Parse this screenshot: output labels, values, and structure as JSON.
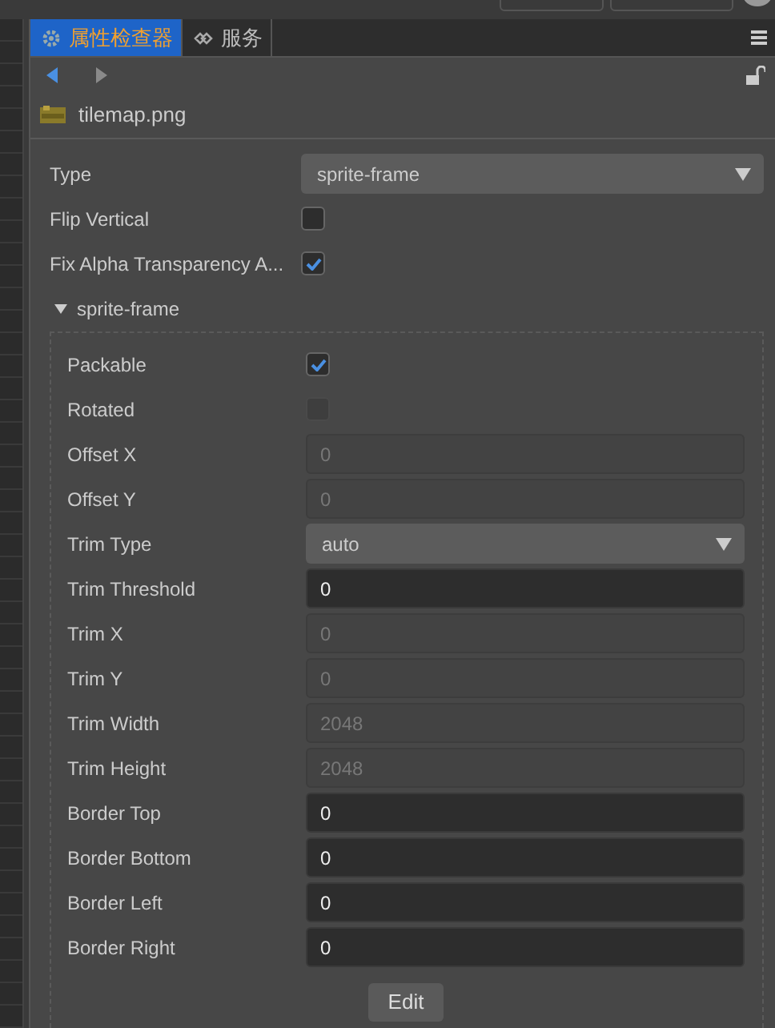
{
  "tabs": [
    {
      "label": "属性检查器",
      "selected": true
    },
    {
      "label": "服务",
      "selected": false
    }
  ],
  "asset": {
    "name": "tilemap.png"
  },
  "properties": [
    {
      "kind": "dropdown",
      "label": "Type",
      "value": "sprite-frame"
    },
    {
      "kind": "checkbox",
      "label": "Flip Vertical",
      "checked": false
    },
    {
      "kind": "checkbox",
      "label": "Fix Alpha Transparency A...",
      "checked": true
    }
  ],
  "section": {
    "title": "sprite-frame",
    "expanded": true,
    "properties": [
      {
        "kind": "checkbox",
        "label": "Packable",
        "checked": true
      },
      {
        "kind": "checkbox",
        "label": "Rotated",
        "checked": false,
        "disabled": true
      },
      {
        "kind": "number",
        "label": "Offset X",
        "value": "0",
        "disabled": true
      },
      {
        "kind": "number",
        "label": "Offset Y",
        "value": "0",
        "disabled": true
      },
      {
        "kind": "dropdown",
        "label": "Trim Type",
        "value": "auto"
      },
      {
        "kind": "number",
        "label": "Trim Threshold",
        "value": "0",
        "disabled": false
      },
      {
        "kind": "number",
        "label": "Trim X",
        "value": "0",
        "disabled": true
      },
      {
        "kind": "number",
        "label": "Trim Y",
        "value": "0",
        "disabled": true
      },
      {
        "kind": "number",
        "label": "Trim Width",
        "value": "2048",
        "disabled": true
      },
      {
        "kind": "number",
        "label": "Trim Height",
        "value": "2048",
        "disabled": true
      },
      {
        "kind": "number",
        "label": "Border Top",
        "value": "0",
        "disabled": false
      },
      {
        "kind": "number",
        "label": "Border Bottom",
        "value": "0",
        "disabled": false
      },
      {
        "kind": "number",
        "label": "Border Left",
        "value": "0",
        "disabled": false
      },
      {
        "kind": "number",
        "label": "Border Right",
        "value": "0",
        "disabled": false
      }
    ],
    "button": "Edit"
  }
}
